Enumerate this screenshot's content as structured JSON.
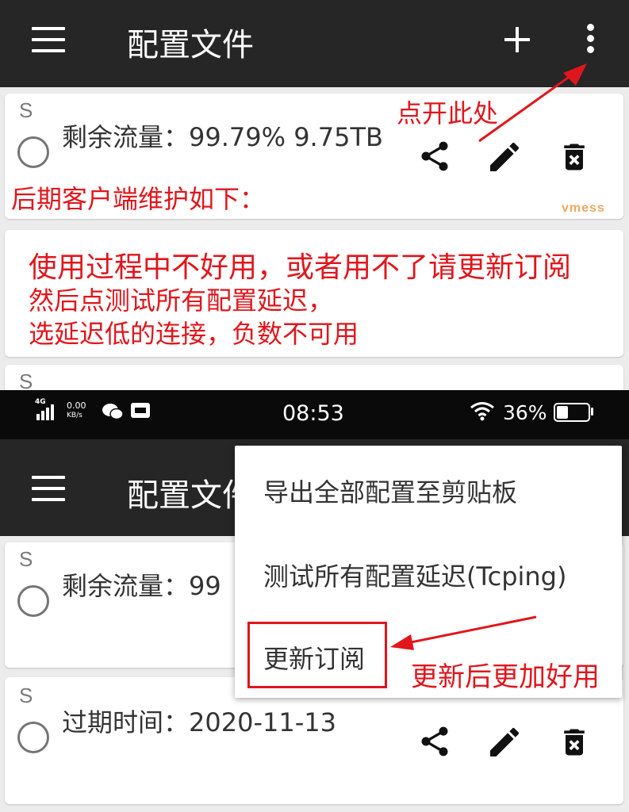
{
  "top": {
    "toolbar": {
      "title": "配置文件"
    },
    "card1": {
      "type_letter": "S",
      "text": "剩余流量：99.79% 9.75TB",
      "protocol_tag": "vmess"
    },
    "card3": {
      "type_letter": "S"
    }
  },
  "annotations": {
    "click_here": "点开此处",
    "maintenance": "后期客户端维护如下：",
    "note_line1": "使用过程中不好用，或者用不了请更新订阅",
    "note_line2": "然后点测试所有配置延迟，",
    "note_line3": "选延迟低的连接，负数不可用",
    "after_update": "更新后更加好用"
  },
  "status_bar": {
    "network_type": "4G",
    "speed_value": "0.00",
    "speed_unit": "KB/s",
    "time": "08:53",
    "battery_percent": "36%",
    "battery_level": 0.36
  },
  "bottom": {
    "toolbar": {
      "title": "配置文件"
    },
    "card1": {
      "type_letter": "S",
      "text": "剩余流量：99"
    },
    "card2": {
      "type_letter": "S",
      "text": "过期时间：2020-11-13"
    }
  },
  "menu": {
    "items": [
      {
        "label": "导出全部配置至剪贴板"
      },
      {
        "label": "测试所有配置延迟(Tcping)"
      },
      {
        "label": "更新订阅"
      }
    ]
  },
  "colors": {
    "toolbar": "#262626",
    "annotation_red": "#e0161c",
    "status_bar": "#0a0a0a"
  }
}
